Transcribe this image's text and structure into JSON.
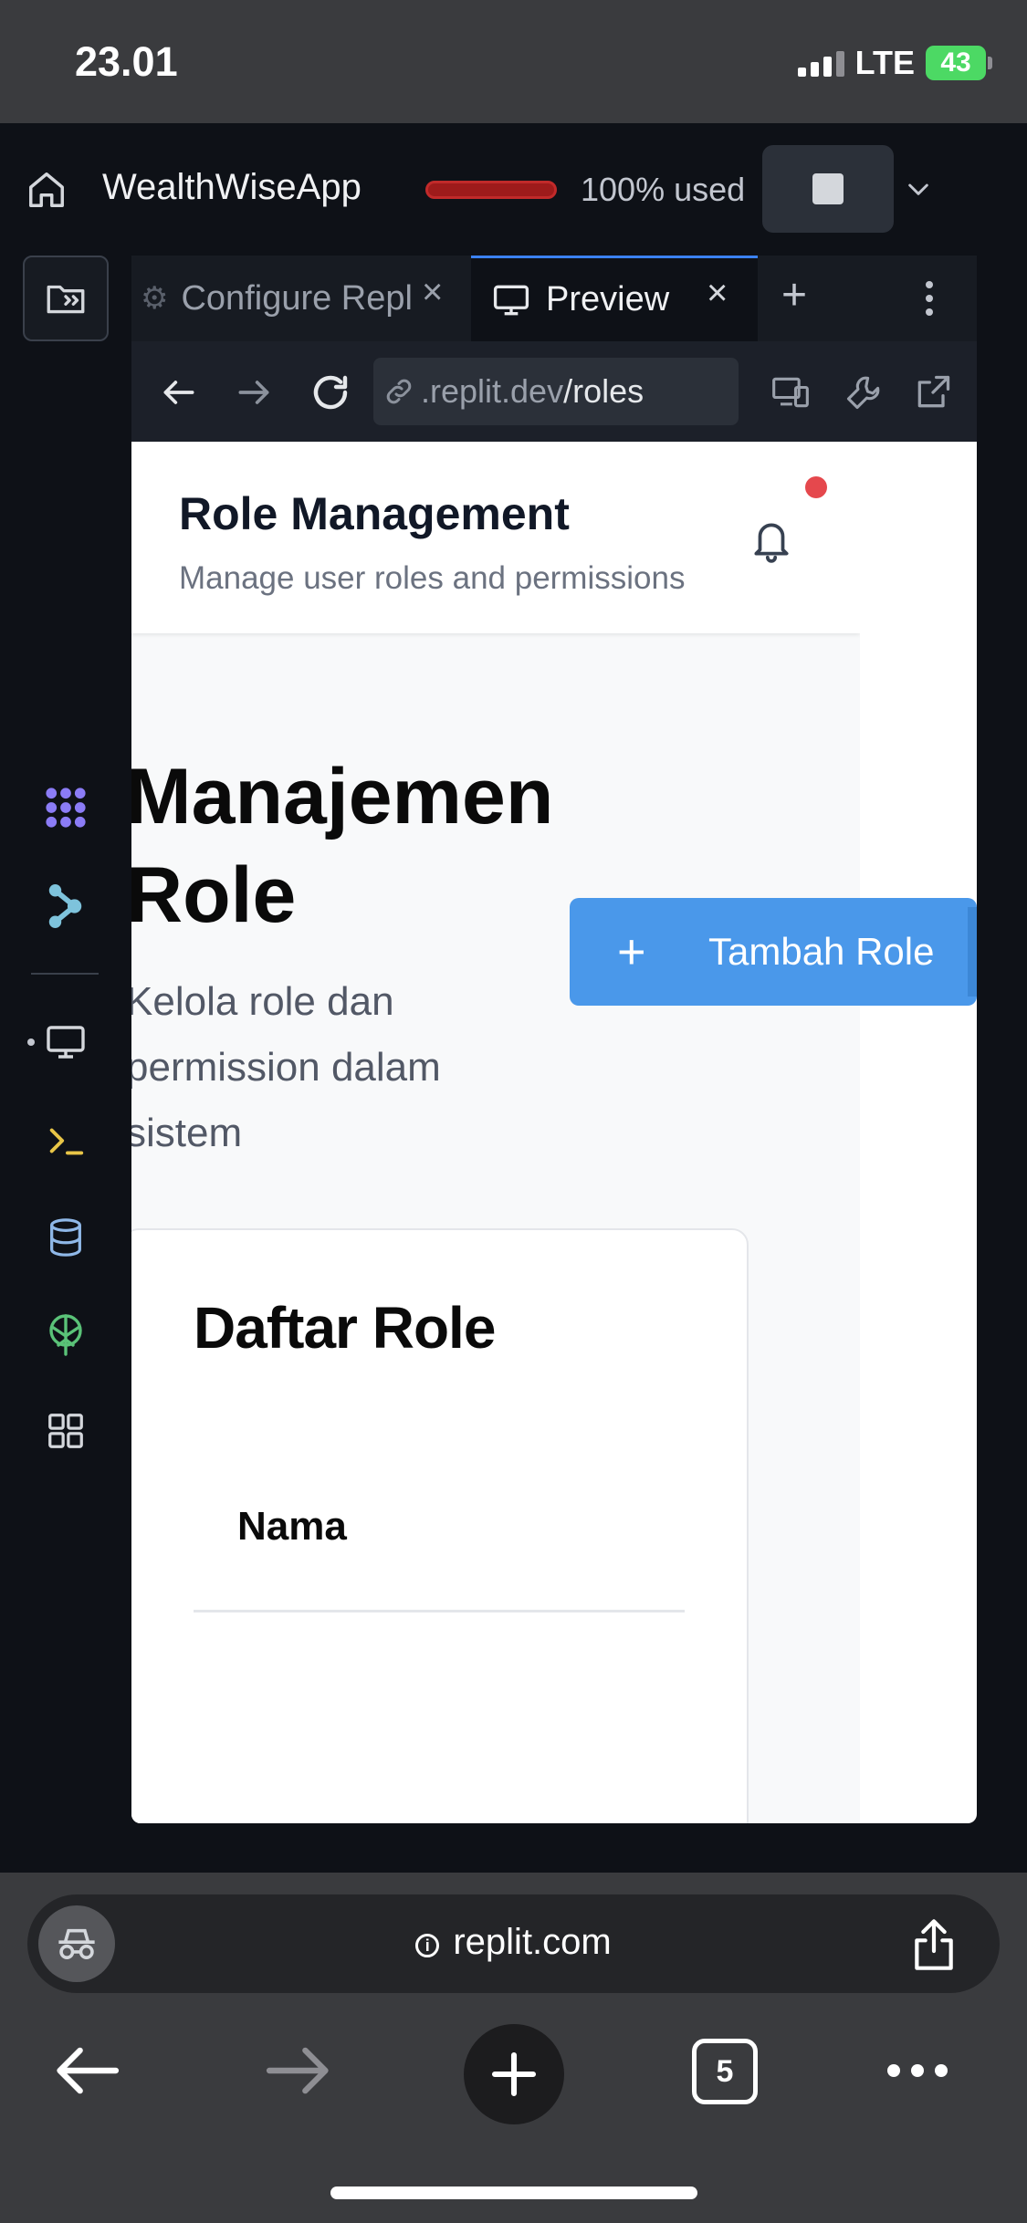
{
  "status_bar": {
    "time": "23.01",
    "network": "LTE",
    "battery": "43"
  },
  "app_bar": {
    "app_name": "WealthWiseApp",
    "usage_text": "100% used"
  },
  "tabs": [
    {
      "label": "Configure Repl",
      "active": false
    },
    {
      "label": "Preview",
      "active": true
    }
  ],
  "preview_toolbar": {
    "url_prefix": ".replit.dev",
    "url_path": "/roles"
  },
  "page": {
    "header_title": "Role Management",
    "header_subtitle": "Manage user roles and permissions",
    "heading": "Manajemen Role",
    "description": "Kelola role dan permission dalam sistem",
    "add_button_label": "Tambah Role",
    "card_title": "Daftar Role",
    "table_columns": [
      "Nama"
    ]
  },
  "safari": {
    "address": "replit.com",
    "tab_count": "5"
  },
  "colors": {
    "accent": "#3b82f6",
    "button": "#4a98ea",
    "usage_bar": "#9e1b1b",
    "notification": "#e5484d"
  }
}
